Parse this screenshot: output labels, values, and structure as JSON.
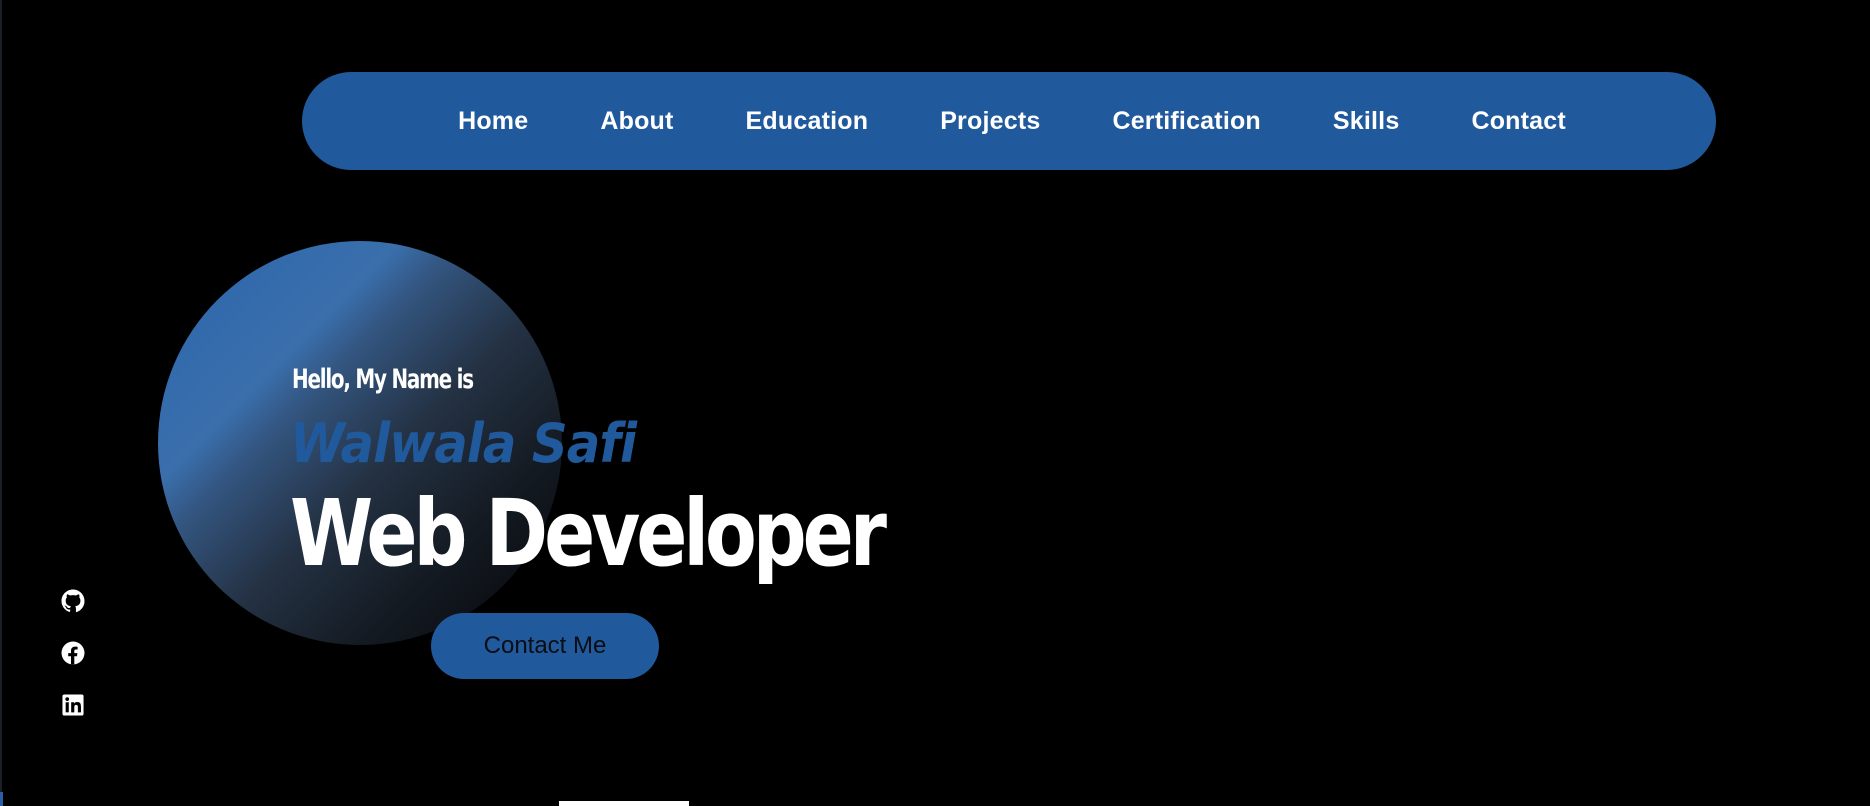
{
  "nav": {
    "items": [
      {
        "label": "Home"
      },
      {
        "label": "About"
      },
      {
        "label": "Education"
      },
      {
        "label": "Projects"
      },
      {
        "label": "Certification"
      },
      {
        "label": "Skills"
      },
      {
        "label": "Contact"
      }
    ]
  },
  "hero": {
    "greeting": "Hello, My Name is",
    "name": "Walwala Safi",
    "role": "Web Developer",
    "cta_label": "Contact Me"
  },
  "social": {
    "icons": [
      "github-icon",
      "facebook-icon",
      "linkedin-icon"
    ]
  },
  "colors": {
    "background": "#000000",
    "accent": "#215a9c",
    "text": "#ffffff"
  }
}
